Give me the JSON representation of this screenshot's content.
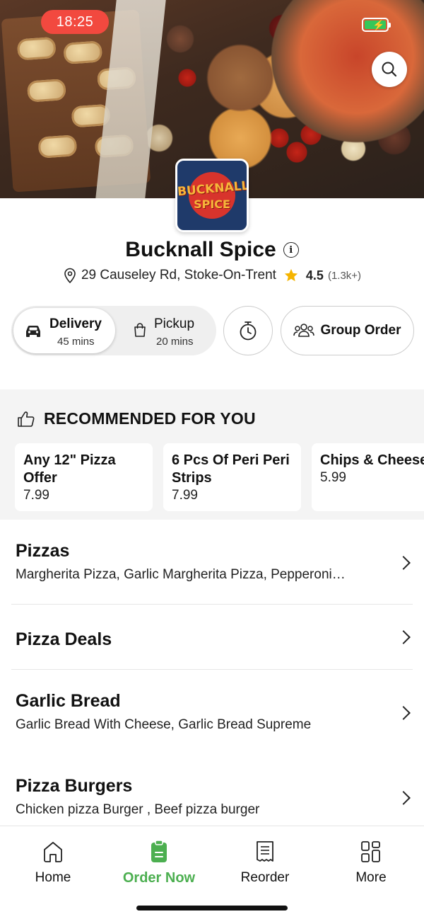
{
  "status_bar": {
    "time": "18:25"
  },
  "colors": {
    "accent_green": "#4caf50",
    "time_pill": "#f2493f",
    "battery": "#35c759",
    "star": "#f5b400"
  },
  "header": {
    "search_icon": "search-icon"
  },
  "restaurant": {
    "name": "Bucknall Spice",
    "logo_line1": "BUCKNALL",
    "logo_line2": "SPICE",
    "address": "29 Causeley Rd, Stoke-On-Trent",
    "rating": "4.5",
    "rating_count": "(1.3k+)"
  },
  "order_mode": {
    "delivery_label": "Delivery",
    "delivery_time": "45 mins",
    "pickup_label": "Pickup",
    "pickup_time": "20 mins",
    "group_order_label": "Group Order"
  },
  "recommended": {
    "title": "RECOMMENDED FOR YOU",
    "items": [
      {
        "name": "Any 12\" Pizza Offer",
        "price": "7.99"
      },
      {
        "name": "6 Pcs Of Peri Peri Strips",
        "price": "7.99"
      },
      {
        "name": "Chips & Cheese Large",
        "price": "5.99"
      }
    ]
  },
  "categories": [
    {
      "name": "Pizzas",
      "desc": "Margherita Pizza, Garlic Margherita Pizza, Pepperoni…"
    },
    {
      "name": "Pizza Deals",
      "desc": ""
    },
    {
      "name": "Garlic Bread",
      "desc": "Garlic Bread With Cheese, Garlic Bread Supreme"
    },
    {
      "name": "Pizza Burgers",
      "desc": "Chicken pizza Burger , Beef pizza burger"
    }
  ],
  "nav": {
    "items": [
      {
        "label": "Home",
        "icon": "home-icon"
      },
      {
        "label": "Order Now",
        "icon": "order-icon"
      },
      {
        "label": "Reorder",
        "icon": "receipt-icon"
      },
      {
        "label": "More",
        "icon": "grid-icon"
      }
    ],
    "active": "Order Now"
  }
}
